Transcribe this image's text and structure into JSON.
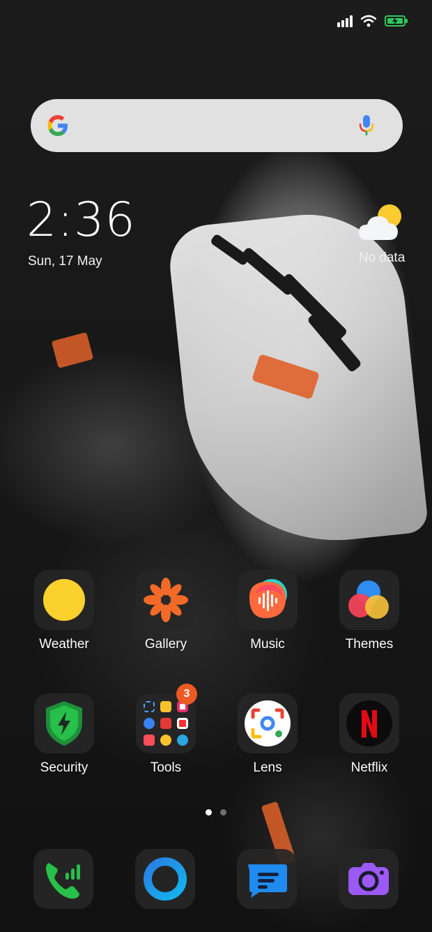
{
  "status_bar": {
    "signal_icon": "cellular-signal-icon",
    "wifi_icon": "wifi-icon",
    "battery_icon": "battery-charging-icon",
    "battery_color": "#2ec95c"
  },
  "search": {
    "placeholder": "",
    "google_icon": "google-g-icon",
    "mic_icon": "microphone-icon"
  },
  "clock": {
    "time": "2:36",
    "date": "Sun, 17 May"
  },
  "weather": {
    "icon": "partly-cloudy-icon",
    "status": "No data"
  },
  "apps": [
    {
      "label": "Weather",
      "icon": "sun-icon"
    },
    {
      "label": "Gallery",
      "icon": "gallery-flower-icon"
    },
    {
      "label": "Music",
      "icon": "music-waveform-icon"
    },
    {
      "label": "Themes",
      "icon": "themes-circles-icon"
    },
    {
      "label": "Security",
      "icon": "shield-bolt-icon"
    },
    {
      "label": "Tools",
      "icon": "folder-icon",
      "badge": "3"
    },
    {
      "label": "Lens",
      "icon": "google-lens-icon"
    },
    {
      "label": "Netflix",
      "icon": "netflix-icon"
    }
  ],
  "pages": {
    "count": 2,
    "active": 1
  },
  "dock": [
    {
      "name": "Phone",
      "icon": "phone-icon"
    },
    {
      "name": "Browser",
      "icon": "browser-ring-icon"
    },
    {
      "name": "Messages",
      "icon": "message-icon"
    },
    {
      "name": "Camera",
      "icon": "camera-icon"
    }
  ],
  "colors": {
    "accent_orange": "#ee5a24",
    "weather_sun": "#fbd12e",
    "security_green": "#27c04a"
  }
}
